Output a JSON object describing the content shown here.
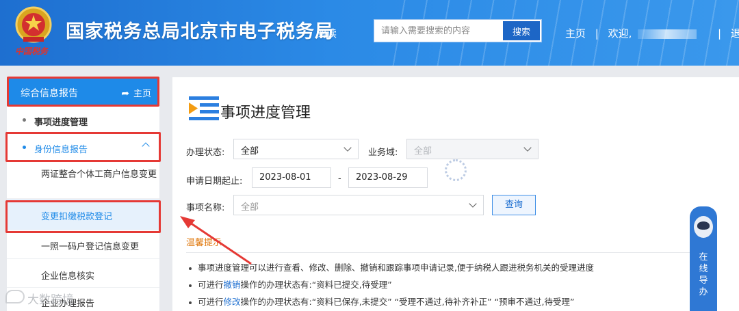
{
  "header": {
    "emblem_text": "中国税务",
    "site_title": "国家税务总局北京市电子税务局",
    "aria_read": "阅读",
    "search": {
      "placeholder": "请输入需要搜索的内容",
      "button": "搜索"
    },
    "nav": {
      "home": "主页",
      "welcome": "欢迎,",
      "logout": "退出"
    }
  },
  "sidebar": {
    "section_title": "综合信息报告",
    "home_link": "主页",
    "items": [
      {
        "label": "事项进度管理"
      },
      {
        "label": "身份信息报告",
        "expanded": true
      },
      {
        "label": "两证整合个体工商户信息变更"
      },
      {
        "label": "变更扣缴税款登记",
        "active": true
      },
      {
        "label": "一照一码户登记信息变更"
      },
      {
        "label": "企业信息核实"
      },
      {
        "label": "企业办理报告"
      }
    ]
  },
  "main": {
    "page_title": "事项进度管理",
    "filters": {
      "status_label": "办理状态:",
      "status_value": "全部",
      "domain_label": "业务域:",
      "domain_value": "全部",
      "date_label": "申请日期起止:",
      "date_from": "2023-08-01",
      "date_sep": "-",
      "date_to": "2023-08-29",
      "item_label": "事项名称:",
      "item_value": "全部",
      "query_button": "查询"
    },
    "tips": {
      "title": "温馨提示",
      "lines": [
        {
          "text": "事项进度管理可以进行查看、修改、删除、撤销和跟踪事项申请记录,便于纳税人跟进税务机关的受理进度"
        },
        {
          "prefix": "可进行",
          "action": "撤销",
          "suffix": "操作的办理状态有:“资料已提交,待受理”"
        },
        {
          "prefix": "可进行",
          "action": "修改",
          "suffix": "操作的办理状态有:“资料已保存,未提交” “受理不通过,待补齐补正” “预审不通过,待受理”"
        }
      ]
    }
  },
  "guide_widget": {
    "chars": [
      "在",
      "线",
      "导",
      "办"
    ]
  },
  "watermark": "大数跨境",
  "colors": {
    "header_blue": "#2b8ae6",
    "sidebar_active": "#1e8ae8",
    "annotation_red": "#e53935",
    "tips_orange": "#e07a10"
  }
}
